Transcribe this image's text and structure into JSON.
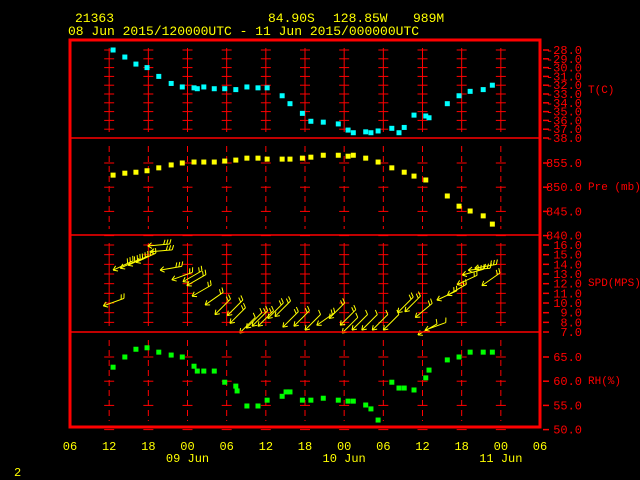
{
  "header": {
    "station_id": "21363",
    "latitude": "84.90S",
    "longitude": "128.85W",
    "elevation": "989M",
    "time_range": "08 Jun 2015/120000UTC - 11 Jun 2015/000000UTC"
  },
  "footer": {
    "page_number": "2"
  },
  "colors": {
    "frame": "#ff0000",
    "text": "#ffff00",
    "temperature": "#00ffff",
    "pressure": "#ffff00",
    "wind": "#ffff00",
    "humidity": "#00ff00"
  },
  "chart_data": {
    "type": "scatter",
    "x_units": "hours since 08 Jun 2015 06 UTC",
    "xlim": [
      0,
      72
    ],
    "x_tick_labels": [
      "06",
      "12",
      "18",
      "00",
      "06",
      "12",
      "18",
      "00",
      "06",
      "12",
      "18",
      "00",
      "06"
    ],
    "date_labels": [
      {
        "label": "09 Jun",
        "hour": 18
      },
      {
        "label": "10 Jun",
        "hour": 42
      },
      {
        "label": "11 Jun",
        "hour": 66
      }
    ],
    "panels": [
      {
        "key": "temperature",
        "title": "T(C)",
        "labels": [
          "-28.0",
          "-29.0",
          "-30.0",
          "-31.0",
          "-32.0",
          "-33.0",
          "-34.0",
          "-35.0",
          "-36.0",
          "-37.0",
          "-38.0"
        ],
        "ylim": [
          -38,
          -28
        ],
        "points": [
          [
            6.6,
            -28.0
          ],
          [
            8.4,
            -28.8
          ],
          [
            10.1,
            -29.6
          ],
          [
            11.8,
            -30.0
          ],
          [
            13.6,
            -31.0
          ],
          [
            15.5,
            -31.8
          ],
          [
            17.2,
            -32.2
          ],
          [
            19.0,
            -32.3
          ],
          [
            19.5,
            -32.4
          ],
          [
            20.5,
            -32.2
          ],
          [
            22.1,
            -32.4
          ],
          [
            23.7,
            -32.4
          ],
          [
            25.4,
            -32.5
          ],
          [
            27.1,
            -32.2
          ],
          [
            28.8,
            -32.3
          ],
          [
            30.2,
            -32.3
          ],
          [
            32.5,
            -33.2
          ],
          [
            33.7,
            -34.1
          ],
          [
            35.6,
            -35.2
          ],
          [
            36.9,
            -36.1
          ],
          [
            38.8,
            -36.2
          ],
          [
            41.1,
            -36.4
          ],
          [
            42.6,
            -37.1
          ],
          [
            43.4,
            -37.4
          ],
          [
            45.3,
            -37.3
          ],
          [
            46.1,
            -37.4
          ],
          [
            47.2,
            -37.2
          ],
          [
            49.3,
            -36.9
          ],
          [
            50.4,
            -37.4
          ],
          [
            51.2,
            -36.8
          ],
          [
            52.7,
            -35.4
          ],
          [
            54.5,
            -35.5
          ],
          [
            55.0,
            -35.7
          ],
          [
            57.8,
            -34.1
          ],
          [
            59.6,
            -33.2
          ],
          [
            61.3,
            -32.7
          ],
          [
            63.3,
            -32.5
          ],
          [
            64.7,
            -32.0
          ]
        ]
      },
      {
        "key": "pressure",
        "title": "Pre (mb)",
        "labels": [
          "855.0",
          "850.0",
          "845.0",
          "840.0"
        ],
        "ylim": [
          840,
          855
        ],
        "points": [
          [
            6.6,
            852.5
          ],
          [
            8.4,
            852.9
          ],
          [
            10.1,
            853.1
          ],
          [
            11.8,
            853.4
          ],
          [
            13.6,
            854.0
          ],
          [
            15.5,
            854.6
          ],
          [
            17.2,
            855.0
          ],
          [
            19.0,
            855.2
          ],
          [
            20.5,
            855.2
          ],
          [
            22.1,
            855.2
          ],
          [
            23.7,
            855.4
          ],
          [
            25.4,
            855.6
          ],
          [
            27.1,
            856.0
          ],
          [
            28.8,
            856.0
          ],
          [
            30.2,
            855.8
          ],
          [
            32.5,
            855.8
          ],
          [
            33.7,
            855.8
          ],
          [
            35.6,
            856.0
          ],
          [
            36.9,
            856.2
          ],
          [
            38.8,
            856.6
          ],
          [
            41.1,
            856.6
          ],
          [
            42.6,
            856.4
          ],
          [
            43.4,
            856.6
          ],
          [
            45.3,
            856.0
          ],
          [
            47.2,
            855.2
          ],
          [
            49.3,
            854.0
          ],
          [
            51.2,
            853.1
          ],
          [
            52.7,
            852.3
          ],
          [
            54.5,
            851.5
          ],
          [
            57.8,
            848.2
          ],
          [
            59.6,
            846.1
          ],
          [
            61.3,
            845.1
          ],
          [
            63.3,
            844.1
          ],
          [
            64.7,
            842.4
          ]
        ]
      },
      {
        "key": "wind",
        "title": "SPD(MPS)",
        "labels": [
          "16.0",
          "15.0",
          "14.0",
          "13.0",
          "12.0",
          "11.0",
          "10.0",
          "9.0",
          "8.0",
          "7.0"
        ],
        "ylim": [
          7,
          16
        ],
        "points_hour_speed_direction": [
          [
            5.1,
            9.7,
            70
          ],
          [
            6.6,
            13.4,
            65
          ],
          [
            7.7,
            13.6,
            65
          ],
          [
            8.9,
            13.9,
            65
          ],
          [
            10.1,
            14.2,
            65
          ],
          [
            11.9,
            15.9,
            85
          ],
          [
            12.3,
            15.3,
            85
          ],
          [
            13.8,
            13.4,
            80
          ],
          [
            15.6,
            12.4,
            70
          ],
          [
            17.3,
            12.2,
            60
          ],
          [
            17.9,
            11.8,
            60
          ],
          [
            18.7,
            10.7,
            60
          ],
          [
            20.7,
            9.8,
            55
          ],
          [
            22.2,
            8.8,
            45
          ],
          [
            24.1,
            8.7,
            45
          ],
          [
            24.5,
            7.9,
            45
          ],
          [
            26.0,
            6.9,
            45
          ],
          [
            27.0,
            7.4,
            45
          ],
          [
            27.9,
            7.6,
            45
          ],
          [
            28.8,
            7.6,
            45
          ],
          [
            30.3,
            8.4,
            45
          ],
          [
            31.4,
            8.6,
            45
          ],
          [
            32.6,
            7.5,
            45
          ],
          [
            34.3,
            7.6,
            45
          ],
          [
            36.0,
            7.2,
            45
          ],
          [
            37.8,
            7.7,
            55
          ],
          [
            39.7,
            8.4,
            45
          ],
          [
            41.4,
            7.7,
            45
          ],
          [
            41.7,
            6.9,
            45
          ],
          [
            43.2,
            7.2,
            45
          ],
          [
            44.7,
            7.2,
            45
          ],
          [
            46.3,
            7.2,
            45
          ],
          [
            48.0,
            7.2,
            45
          ],
          [
            50.2,
            9.0,
            45
          ],
          [
            51.3,
            9.1,
            45
          ],
          [
            52.9,
            8.5,
            50
          ],
          [
            53.3,
            6.7,
            60
          ],
          [
            54.4,
            7.2,
            70
          ],
          [
            56.2,
            10.3,
            65
          ],
          [
            57.8,
            10.8,
            60
          ],
          [
            59.3,
            11.9,
            65
          ],
          [
            60.1,
            12.9,
            75
          ],
          [
            61.0,
            13.4,
            85
          ],
          [
            62.0,
            13.6,
            80
          ],
          [
            63.1,
            11.8,
            55
          ]
        ]
      },
      {
        "key": "humidity",
        "title": "RH(%)",
        "labels": [
          "65.0",
          "60.0",
          "55.0",
          "50.0"
        ],
        "ylim": [
          50,
          65
        ],
        "points": [
          [
            6.6,
            62.9
          ],
          [
            8.4,
            65.0
          ],
          [
            10.1,
            66.6
          ],
          [
            11.8,
            66.9
          ],
          [
            13.6,
            66.0
          ],
          [
            15.5,
            65.4
          ],
          [
            17.2,
            65.0
          ],
          [
            19.0,
            63.1
          ],
          [
            19.5,
            62.1
          ],
          [
            20.5,
            62.1
          ],
          [
            22.1,
            62.1
          ],
          [
            23.7,
            59.8
          ],
          [
            25.4,
            59.0
          ],
          [
            25.6,
            58.0
          ],
          [
            27.1,
            54.9
          ],
          [
            28.8,
            54.9
          ],
          [
            30.2,
            56.1
          ],
          [
            32.5,
            56.9
          ],
          [
            33.1,
            57.8
          ],
          [
            33.7,
            57.8
          ],
          [
            35.6,
            56.1
          ],
          [
            36.9,
            56.1
          ],
          [
            38.8,
            56.5
          ],
          [
            41.1,
            56.1
          ],
          [
            42.6,
            55.9
          ],
          [
            43.4,
            55.9
          ],
          [
            45.3,
            55.1
          ],
          [
            46.1,
            54.3
          ],
          [
            47.2,
            52.0
          ],
          [
            49.3,
            59.8
          ],
          [
            50.4,
            58.6
          ],
          [
            51.2,
            58.6
          ],
          [
            52.7,
            58.2
          ],
          [
            54.5,
            60.7
          ],
          [
            55.0,
            62.3
          ],
          [
            57.8,
            64.4
          ],
          [
            59.6,
            65.0
          ],
          [
            61.3,
            66.0
          ],
          [
            63.3,
            66.0
          ],
          [
            64.7,
            66.0
          ]
        ]
      }
    ]
  }
}
